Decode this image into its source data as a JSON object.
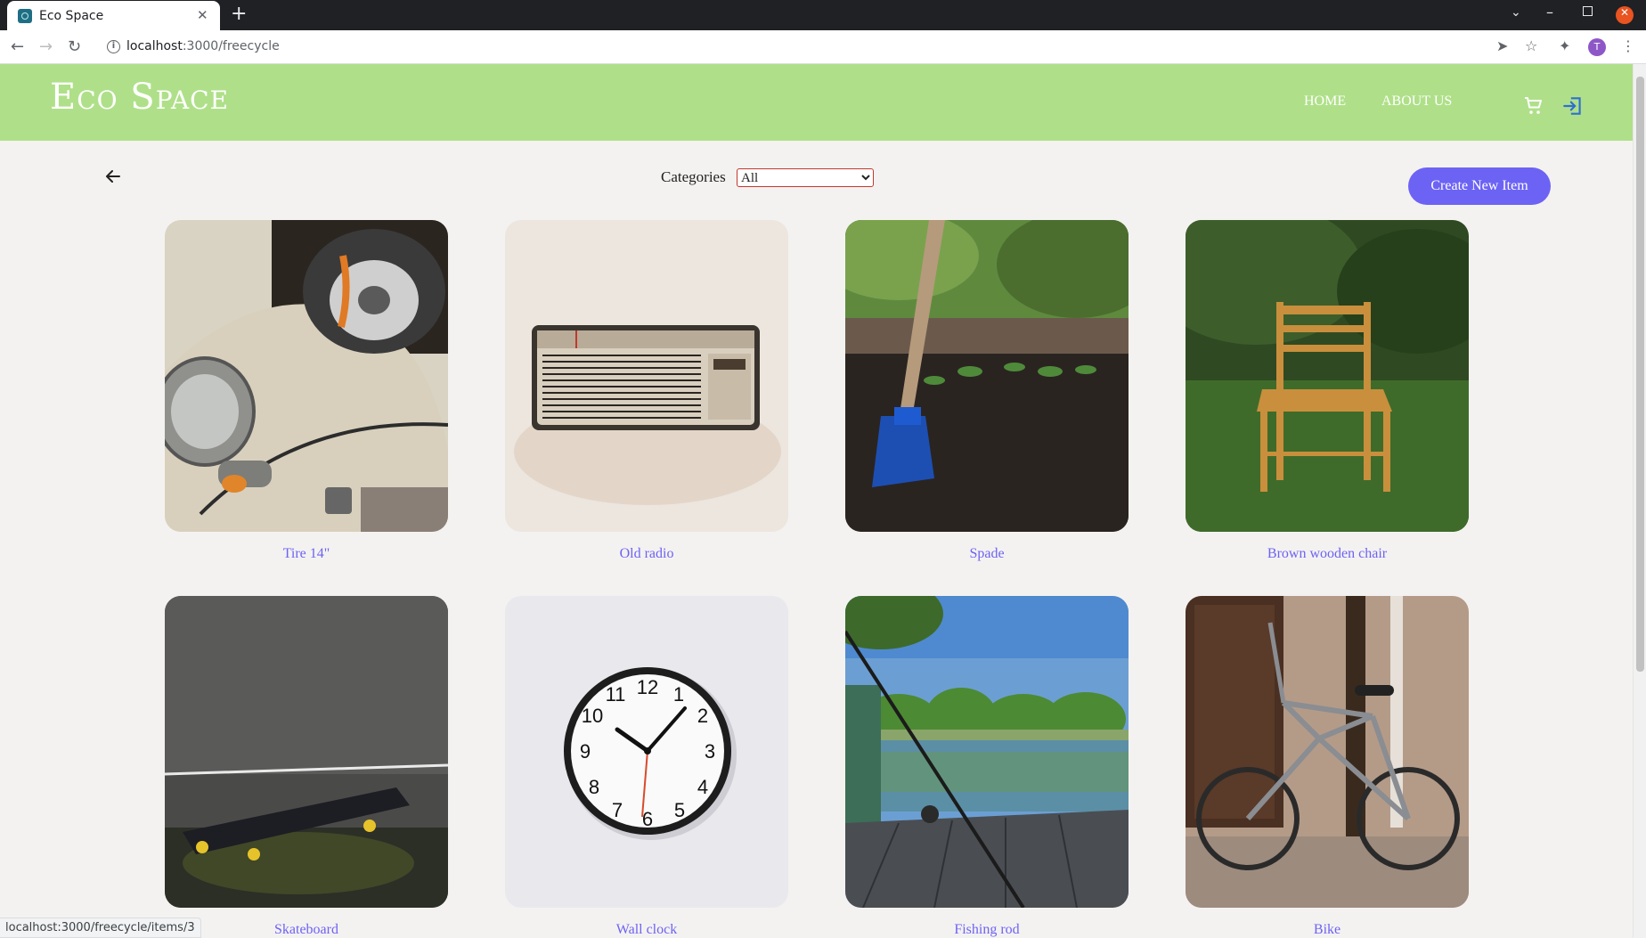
{
  "browser": {
    "tab_title": "Eco Space",
    "tab_close": "✕",
    "new_tab": "+",
    "url_host": "localhost",
    "url_rest": ":3000/freecycle",
    "profile_initial": "T",
    "status_url": "localhost:3000/freecycle/items/3"
  },
  "header": {
    "brand": "Eco Space",
    "nav": {
      "home": "HOME",
      "about": "ABOUT US"
    },
    "icons": [
      "cart-icon",
      "login-icon"
    ]
  },
  "filters": {
    "categories_label": "Categories",
    "selected_category": "All"
  },
  "actions": {
    "create_label": "Create New Item"
  },
  "colors": {
    "header_bg": "#afe089",
    "accent": "#6c63f5",
    "page_bg": "#f4f2f0"
  },
  "items": [
    {
      "name": "Tire 14\""
    },
    {
      "name": "Old radio"
    },
    {
      "name": "Spade"
    },
    {
      "name": "Brown wooden chair"
    },
    {
      "name": "Skateboard"
    },
    {
      "name": "Wall clock"
    },
    {
      "name": "Fishing rod"
    },
    {
      "name": "Bike"
    }
  ]
}
